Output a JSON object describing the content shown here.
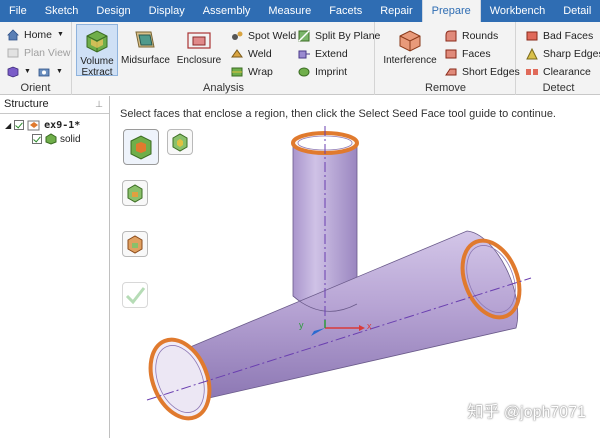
{
  "menu": {
    "tabs": [
      "File",
      "Sketch",
      "Design",
      "Display",
      "Assembly",
      "Measure",
      "Facets",
      "Repair",
      "Prepare",
      "Workbench",
      "Detail"
    ],
    "active_tab": "Prepare"
  },
  "orient": {
    "home_label": "Home",
    "plan_view_label": "Plan View",
    "group_label": "Orient"
  },
  "analysis": {
    "volume_extract_label": "Volume\nExtract",
    "midsurface_label": "Midsurface",
    "enclosure_label": "Enclosure",
    "spot_weld_label": "Spot Weld",
    "weld_label": "Weld",
    "wrap_label": "Wrap",
    "split_by_plane_label": "Split By Plane",
    "extend_label": "Extend",
    "imprint_label": "Imprint",
    "group_label": "Analysis"
  },
  "remove": {
    "interference_label": "Interference",
    "rounds_label": "Rounds",
    "faces_label": "Faces",
    "short_edges_label": "Short Edges",
    "group_label": "Remove"
  },
  "detect": {
    "bad_faces_label": "Bad Faces",
    "sharp_edges_label": "Sharp Edges",
    "clearance_label": "Clearance",
    "group_label": "Detect"
  },
  "structure": {
    "title": "Structure",
    "root_label": "ex9-1*",
    "child_label": "solid"
  },
  "viewport": {
    "hint": "Select faces that enclose a region, then click the Select Seed Face tool guide to continue.",
    "axis_x": "x",
    "axis_y": "y"
  },
  "watermark": "知乎 @joph7071",
  "colors": {
    "menubar": "#2f6db3",
    "pipe_fill": "#b9a7d4",
    "pipe_edge": "#e07a2e",
    "centerline": "#6a3fb0"
  }
}
